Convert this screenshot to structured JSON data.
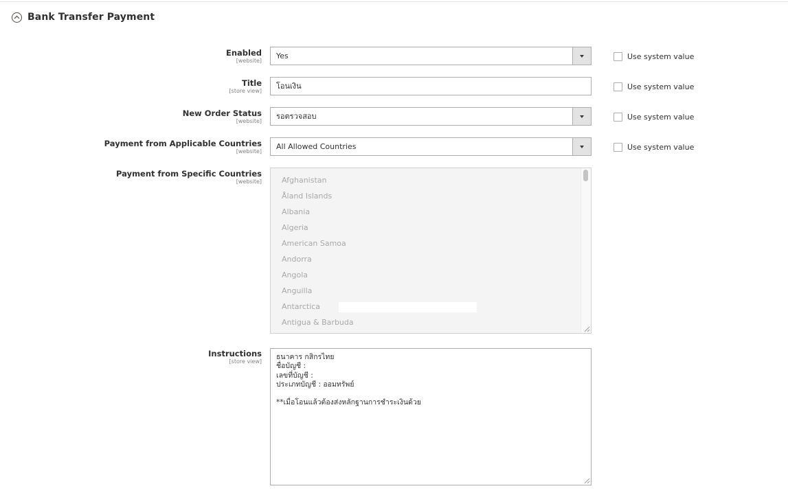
{
  "section": {
    "title": "Bank Transfer Payment",
    "icon": "collapse-circle-chevron-up-icon"
  },
  "fields": {
    "enabled": {
      "label": "Enabled",
      "scope": "[website]",
      "value": "Yes",
      "use_system": "Use system value"
    },
    "title": {
      "label": "Title",
      "scope": "[store view]",
      "value": "โอนเงิน",
      "use_system": "Use system value"
    },
    "new_order_status": {
      "label": "New Order Status",
      "scope": "[website]",
      "value": "รอตรวจสอบ",
      "use_system": "Use system value"
    },
    "applicable_countries": {
      "label": "Payment from Applicable Countries",
      "scope": "[website]",
      "value": "All Allowed Countries",
      "use_system": "Use system value"
    },
    "specific_countries": {
      "label": "Payment from Specific Countries",
      "scope": "[website]",
      "options": [
        "Afghanistan",
        "Åland Islands",
        "Albania",
        "Algeria",
        "American Samoa",
        "Andorra",
        "Angola",
        "Anguilla",
        "Antarctica",
        "Antigua & Barbuda"
      ]
    },
    "instructions": {
      "label": "Instructions",
      "scope": "[store view]",
      "lines": [
        "ธนาคาร กสิกรไทย",
        "ชื่อบัญชี :",
        "เลขที่บัญชี :",
        "ประเภทบัญชี : ออมทรัพย์",
        "",
        "**เมื่อโอนแล้วต้องส่งหลักฐานการชำระเงินด้วย"
      ]
    }
  }
}
